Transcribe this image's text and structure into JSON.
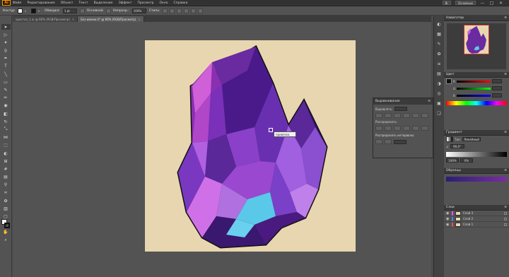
{
  "app": {
    "logo": "Ai"
  },
  "menu": [
    "Файл",
    "Редактирование",
    "Объект",
    "Текст",
    "Выделение",
    "Эффект",
    "Просмотр",
    "Окно",
    "Справка"
  ],
  "menubar_right": {
    "bridge": "Br",
    "workspace": "Основные"
  },
  "window_controls": [
    "—",
    "□",
    "✕"
  ],
  "control_bar": {
    "path_label": "Контур",
    "stroke_label": "Обводка:",
    "opacity_label": "Непрозр.:",
    "style_label": "Стиль:",
    "uniform_label": "Основной",
    "stroke_value": "1 pt",
    "opacity_value": "100%"
  },
  "tabs": [
    {
      "label": "кристал_1.ai @ 66% (RGB/Просмотр)",
      "active": false
    },
    {
      "label": "Без имени-2* @ 66% (RGB/Просмотр)",
      "active": true
    }
  ],
  "tooltip": {
    "text": "привязка"
  },
  "float_panel": {
    "title": "Выравнивание",
    "row1": "Выровнять:",
    "row2": "Распределить:",
    "section": "Распределить интервалы:"
  },
  "right_panels": {
    "navigator_title": "Навигатор",
    "color_title": "Цвет",
    "color_rows": [
      {
        "label": "R",
        "value": ""
      },
      {
        "label": "G",
        "value": ""
      },
      {
        "label": "B",
        "value": ""
      }
    ],
    "gradient_title": "Градиент",
    "gradient_type_label": "Тип:",
    "gradient_type_value": "Линейный",
    "gradient_angle": "90,0°",
    "gradient_opacity": "100%",
    "gradient_location": "0%",
    "swatch_title": "Образцы",
    "layers_title": "Слои",
    "layers": [
      {
        "name": "Слой 3",
        "color": "#e84fe8"
      },
      {
        "name": "Слой 2",
        "color": "#4f7de8"
      },
      {
        "name": "Слой 1",
        "color": "#e84f4f"
      }
    ]
  },
  "colors": {
    "canvas": "#535353",
    "artboard": "#e8d6b0",
    "panel_bg": "#535353",
    "crystal_dark": "#3a1870",
    "crystal_light": "#c85adf",
    "crystal_cyan": "#5ac8e8"
  }
}
